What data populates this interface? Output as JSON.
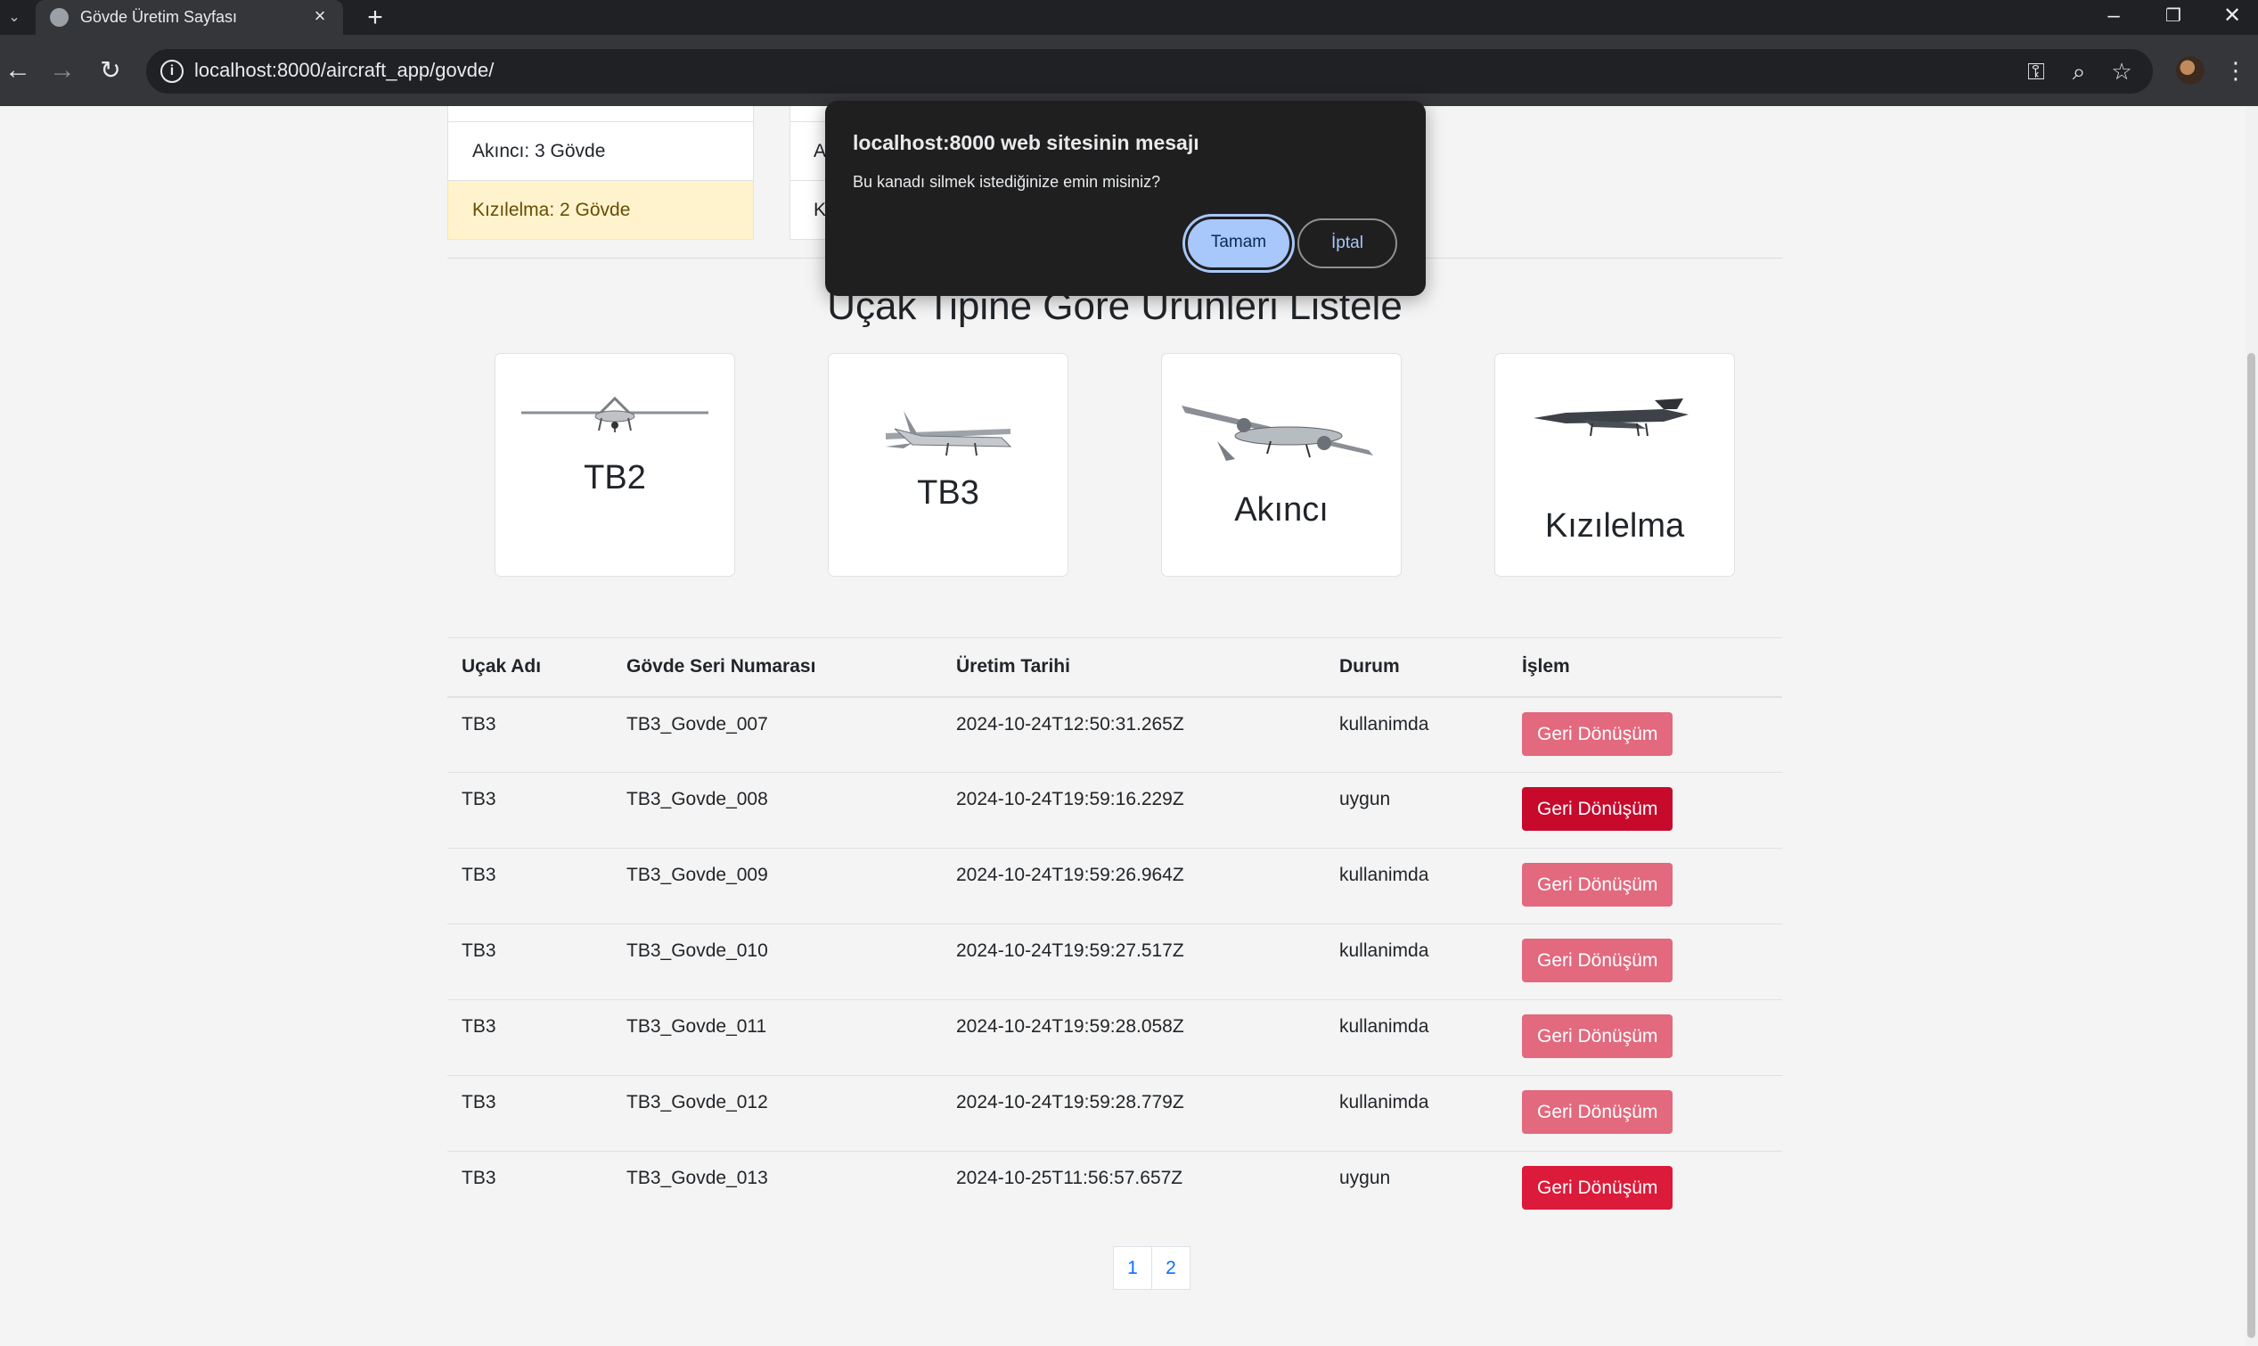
{
  "browser": {
    "tab_title": "Gövde Üretim Sayfası",
    "new_tab": "+",
    "url": "localhost:8000/aircraft_app/govde/"
  },
  "stats": {
    "left": [
      {
        "label": "Akıncı: 3 Gövde"
      },
      {
        "label": "Kızılelma: 2 Gövde"
      }
    ],
    "right": [
      {
        "label": "A"
      },
      {
        "label": "K"
      }
    ]
  },
  "section_title": "Uçak Tipine Göre Ürünleri Listele",
  "aircraft_types": [
    {
      "name": "TB2",
      "icon": "tb2-drone-icon"
    },
    {
      "name": "TB3",
      "icon": "tb3-drone-icon"
    },
    {
      "name": "Akıncı",
      "icon": "akinci-drone-icon"
    },
    {
      "name": "Kızılelma",
      "icon": "kizilelma-drone-icon"
    }
  ],
  "table": {
    "headers": [
      "Uçak Adı",
      "Gövde Seri Numarası",
      "Üretim Tarihi",
      "Durum",
      "İşlem"
    ],
    "rows": [
      {
        "aircraft": "TB3",
        "serial": "TB3_Govde_007",
        "date": "2024-10-24T12:50:31.265Z",
        "status": "kullanimda",
        "action": "Geri Dönüşüm"
      },
      {
        "aircraft": "TB3",
        "serial": "TB3_Govde_008",
        "date": "2024-10-24T19:59:16.229Z",
        "status": "uygun",
        "action": "Geri Dönüşüm"
      },
      {
        "aircraft": "TB3",
        "serial": "TB3_Govde_009",
        "date": "2024-10-24T19:59:26.964Z",
        "status": "kullanimda",
        "action": "Geri Dönüşüm"
      },
      {
        "aircraft": "TB3",
        "serial": "TB3_Govde_010",
        "date": "2024-10-24T19:59:27.517Z",
        "status": "kullanimda",
        "action": "Geri Dönüşüm"
      },
      {
        "aircraft": "TB3",
        "serial": "TB3_Govde_011",
        "date": "2024-10-24T19:59:28.058Z",
        "status": "kullanimda",
        "action": "Geri Dönüşüm"
      },
      {
        "aircraft": "TB3",
        "serial": "TB3_Govde_012",
        "date": "2024-10-24T19:59:28.779Z",
        "status": "kullanimda",
        "action": "Geri Dönüşüm"
      },
      {
        "aircraft": "TB3",
        "serial": "TB3_Govde_013",
        "date": "2024-10-25T11:56:57.657Z",
        "status": "uygun",
        "action": "Geri Dönüşüm"
      }
    ]
  },
  "pagination": [
    "1",
    "2"
  ],
  "dialog": {
    "title": "localhost:8000 web sitesinin mesajı",
    "message": "Bu kanadı silmek istediğinize emin misiniz?",
    "ok_label": "Tamam",
    "cancel_label": "İptal"
  },
  "colors": {
    "button_disabled": "#e2697e",
    "button_active": "#dc1a3a",
    "warning_bg": "#fff3cd",
    "dialog_ok": "#a8c7fa"
  }
}
